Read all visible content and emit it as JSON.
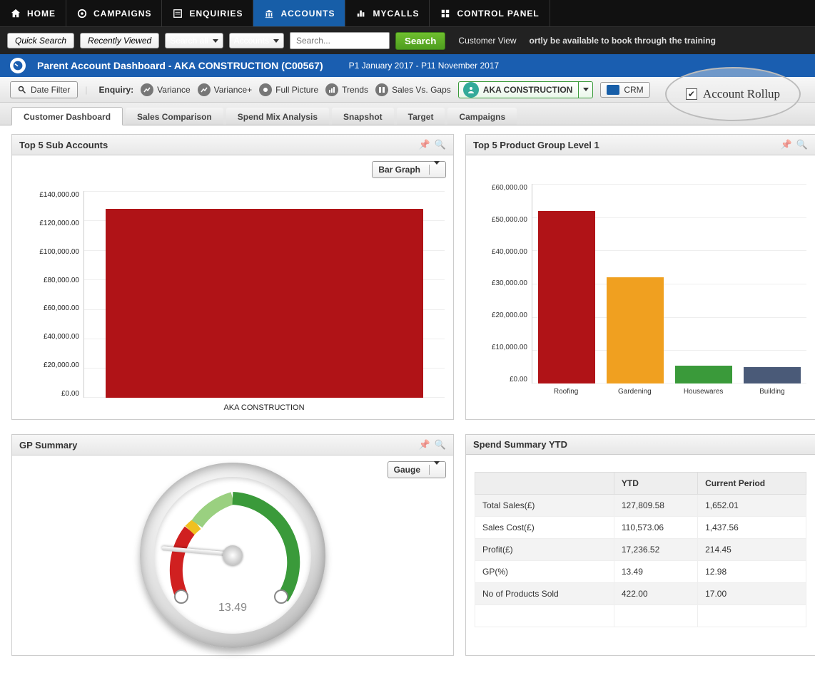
{
  "nav": {
    "home": "HOME",
    "campaigns": "CAMPAIGNS",
    "enquiries": "ENQUIRIES",
    "accounts": "ACCOUNTS",
    "mycalls": "MYCALLS",
    "control_panel": "CONTROL PANEL"
  },
  "secondary": {
    "quick_search": "Quick Search",
    "recently_viewed": "Recently Viewed",
    "search_all": "Search all",
    "accounts": "Accounts",
    "search_placeholder": "Search...",
    "search_btn": "Search",
    "customer_view": "Customer View",
    "ticker": "ortly be available to book through the training"
  },
  "titlebar": {
    "title": "Parent Account Dashboard - AKA CONSTRUCTION (C00567)",
    "period": "P1 January 2017 - P11 November 2017"
  },
  "filter": {
    "date_filter": "Date Filter",
    "enquiry_label": "Enquiry:",
    "variance": "Variance",
    "variance_plus": "Variance+",
    "full_picture": "Full Picture",
    "trends": "Trends",
    "sales_vs_gaps": "Sales Vs. Gaps",
    "account": "AKA CONSTRUCTION",
    "crm": "CRM",
    "rollup": "Account Rollup"
  },
  "tabs": {
    "customer_dashboard": "Customer Dashboard",
    "sales_comparison": "Sales Comparison",
    "spend_mix": "Spend Mix Analysis",
    "snapshot": "Snapshot",
    "target": "Target",
    "campaigns": "Campaigns"
  },
  "panels": {
    "top_sub": "Top 5 Sub Accounts",
    "top_prod": "Top 5 Product Group Level 1",
    "gp_summary": "GP Summary",
    "spend_summary": "Spend Summary YTD",
    "bar_graph": "Bar Graph",
    "gauge": "Gauge"
  },
  "gauge_value": "13.49",
  "spend_table": {
    "col_ytd": "YTD",
    "col_current": "Current Period",
    "rows": [
      {
        "label": "Total Sales(£)",
        "ytd": "127,809.58",
        "cur": "1,652.01"
      },
      {
        "label": "Sales Cost(£)",
        "ytd": "110,573.06",
        "cur": "1,437.56"
      },
      {
        "label": "Profit(£)",
        "ytd": "17,236.52",
        "cur": "214.45"
      },
      {
        "label": "GP(%)",
        "ytd": "13.49",
        "cur": "12.98"
      },
      {
        "label": "No of Products Sold",
        "ytd": "422.00",
        "cur": "17.00"
      }
    ]
  },
  "chart_data": [
    {
      "type": "bar",
      "title": "Top 5 Sub Accounts",
      "categories": [
        "AKA CONSTRUCTION"
      ],
      "values": [
        127810
      ],
      "ylabel": "£",
      "ylim": [
        0,
        140000
      ],
      "yticks": [
        "£0.00",
        "£20,000.00",
        "£40,000.00",
        "£60,000.00",
        "£80,000.00",
        "£100,000.00",
        "£120,000.00",
        "£140,000.00"
      ],
      "colors": [
        "#b01317"
      ]
    },
    {
      "type": "bar",
      "title": "Top 5 Product Group Level 1",
      "categories": [
        "Roofing",
        "Gardening",
        "Housewares",
        "Building"
      ],
      "values": [
        52000,
        32000,
        5500,
        5000
      ],
      "ylabel": "£",
      "ylim": [
        0,
        60000
      ],
      "yticks": [
        "£0.00",
        "£10,000.00",
        "£20,000.00",
        "£30,000.00",
        "£40,000.00",
        "£50,000.00",
        "£60,000.00"
      ],
      "colors": [
        "#b01317",
        "#f0a020",
        "#3a9a3a",
        "#4a5a78"
      ]
    },
    {
      "type": "gauge",
      "title": "GP Summary",
      "value": 13.49,
      "min": 0,
      "max": 100
    }
  ]
}
